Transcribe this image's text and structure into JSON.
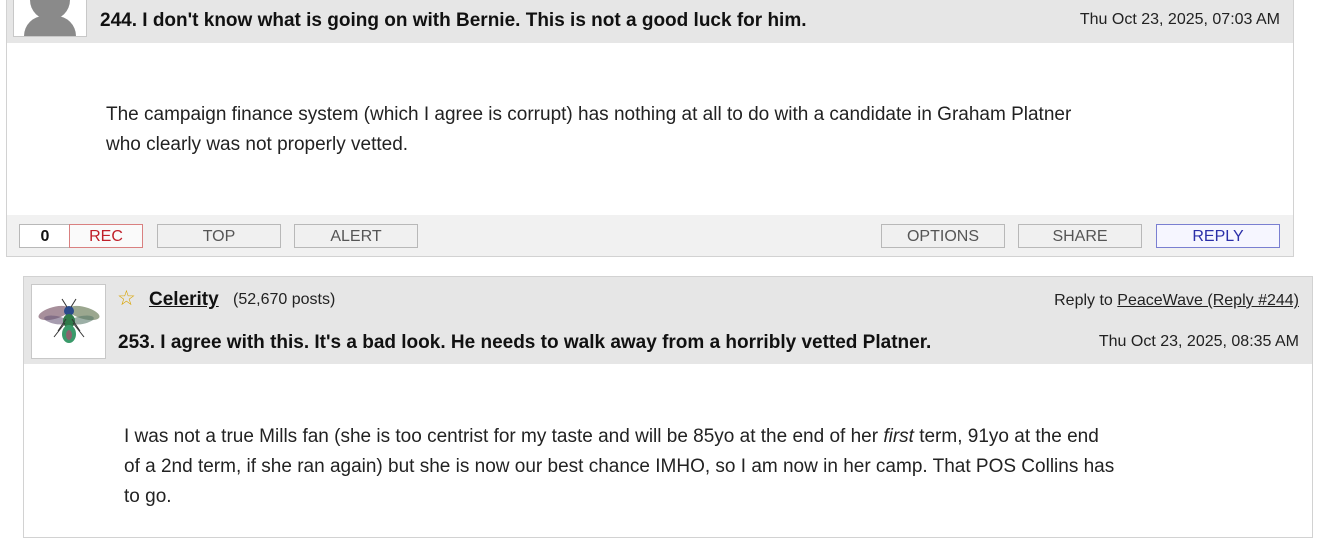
{
  "post1": {
    "subject": "244. I don't know what is going on with Bernie. This is not a good luck for him.",
    "date": "Thu Oct 23, 2025, 07:03 AM",
    "body_line1": "The campaign finance system (which I agree is corrupt) has nothing at all to do with a candidate in Graham Platner",
    "body_line2": "who clearly was not properly vetted.",
    "rec_count": "0",
    "rec_label": "REC",
    "top_label": "TOP",
    "alert_label": "ALERT",
    "options_label": "OPTIONS",
    "share_label": "SHARE",
    "reply_label": "REPLY"
  },
  "post2": {
    "username": "Celerity",
    "post_count": "(52,670 posts)",
    "reply_to_prefix": "Reply to",
    "reply_to_link": "PeaceWave (Reply #244)",
    "subject": "253. I agree with this. It's a bad look. He needs to walk away from a horribly vetted Platner.",
    "date": "Thu Oct 23, 2025, 08:35 AM",
    "body_line1_a": "I was not a true Mills fan (she is too centrist for my taste and will be 85yo at the end of her ",
    "body_line1_em": "first",
    "body_line1_b": " term, 91yo at the end",
    "body_line2": "of a 2nd term, if she ran again) but she is now our best chance IMHO, so I am now in her camp. That POS Collins has",
    "body_line3": "to go."
  },
  "icons": {
    "avatar1": "default-user-silhouette",
    "avatar2": "wasp-insect-avatar",
    "star": "star-icon",
    "colors": {
      "rec": "#c0202a",
      "reply": "#2b2fa8",
      "header_bg": "#e6e6e6",
      "star": "#d9a400"
    }
  }
}
